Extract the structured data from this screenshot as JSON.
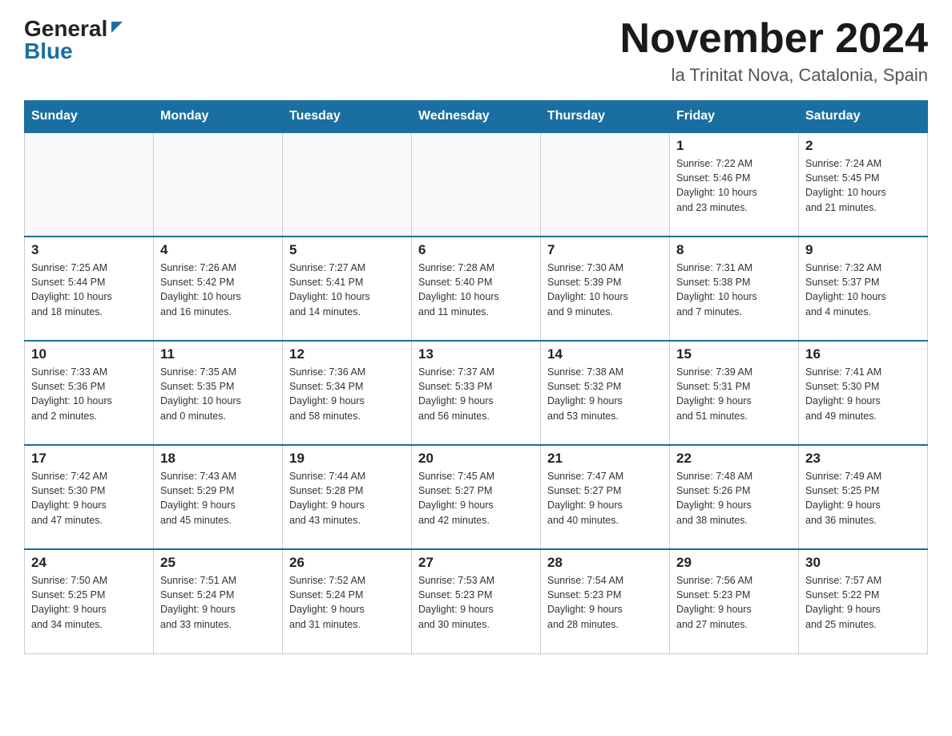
{
  "header": {
    "logo_general": "General",
    "logo_blue": "Blue",
    "month_title": "November 2024",
    "location": "la Trinitat Nova, Catalonia, Spain"
  },
  "days_of_week": [
    "Sunday",
    "Monday",
    "Tuesday",
    "Wednesday",
    "Thursday",
    "Friday",
    "Saturday"
  ],
  "weeks": [
    [
      {
        "day": "",
        "info": ""
      },
      {
        "day": "",
        "info": ""
      },
      {
        "day": "",
        "info": ""
      },
      {
        "day": "",
        "info": ""
      },
      {
        "day": "",
        "info": ""
      },
      {
        "day": "1",
        "info": "Sunrise: 7:22 AM\nSunset: 5:46 PM\nDaylight: 10 hours\nand 23 minutes."
      },
      {
        "day": "2",
        "info": "Sunrise: 7:24 AM\nSunset: 5:45 PM\nDaylight: 10 hours\nand 21 minutes."
      }
    ],
    [
      {
        "day": "3",
        "info": "Sunrise: 7:25 AM\nSunset: 5:44 PM\nDaylight: 10 hours\nand 18 minutes."
      },
      {
        "day": "4",
        "info": "Sunrise: 7:26 AM\nSunset: 5:42 PM\nDaylight: 10 hours\nand 16 minutes."
      },
      {
        "day": "5",
        "info": "Sunrise: 7:27 AM\nSunset: 5:41 PM\nDaylight: 10 hours\nand 14 minutes."
      },
      {
        "day": "6",
        "info": "Sunrise: 7:28 AM\nSunset: 5:40 PM\nDaylight: 10 hours\nand 11 minutes."
      },
      {
        "day": "7",
        "info": "Sunrise: 7:30 AM\nSunset: 5:39 PM\nDaylight: 10 hours\nand 9 minutes."
      },
      {
        "day": "8",
        "info": "Sunrise: 7:31 AM\nSunset: 5:38 PM\nDaylight: 10 hours\nand 7 minutes."
      },
      {
        "day": "9",
        "info": "Sunrise: 7:32 AM\nSunset: 5:37 PM\nDaylight: 10 hours\nand 4 minutes."
      }
    ],
    [
      {
        "day": "10",
        "info": "Sunrise: 7:33 AM\nSunset: 5:36 PM\nDaylight: 10 hours\nand 2 minutes."
      },
      {
        "day": "11",
        "info": "Sunrise: 7:35 AM\nSunset: 5:35 PM\nDaylight: 10 hours\nand 0 minutes."
      },
      {
        "day": "12",
        "info": "Sunrise: 7:36 AM\nSunset: 5:34 PM\nDaylight: 9 hours\nand 58 minutes."
      },
      {
        "day": "13",
        "info": "Sunrise: 7:37 AM\nSunset: 5:33 PM\nDaylight: 9 hours\nand 56 minutes."
      },
      {
        "day": "14",
        "info": "Sunrise: 7:38 AM\nSunset: 5:32 PM\nDaylight: 9 hours\nand 53 minutes."
      },
      {
        "day": "15",
        "info": "Sunrise: 7:39 AM\nSunset: 5:31 PM\nDaylight: 9 hours\nand 51 minutes."
      },
      {
        "day": "16",
        "info": "Sunrise: 7:41 AM\nSunset: 5:30 PM\nDaylight: 9 hours\nand 49 minutes."
      }
    ],
    [
      {
        "day": "17",
        "info": "Sunrise: 7:42 AM\nSunset: 5:30 PM\nDaylight: 9 hours\nand 47 minutes."
      },
      {
        "day": "18",
        "info": "Sunrise: 7:43 AM\nSunset: 5:29 PM\nDaylight: 9 hours\nand 45 minutes."
      },
      {
        "day": "19",
        "info": "Sunrise: 7:44 AM\nSunset: 5:28 PM\nDaylight: 9 hours\nand 43 minutes."
      },
      {
        "day": "20",
        "info": "Sunrise: 7:45 AM\nSunset: 5:27 PM\nDaylight: 9 hours\nand 42 minutes."
      },
      {
        "day": "21",
        "info": "Sunrise: 7:47 AM\nSunset: 5:27 PM\nDaylight: 9 hours\nand 40 minutes."
      },
      {
        "day": "22",
        "info": "Sunrise: 7:48 AM\nSunset: 5:26 PM\nDaylight: 9 hours\nand 38 minutes."
      },
      {
        "day": "23",
        "info": "Sunrise: 7:49 AM\nSunset: 5:25 PM\nDaylight: 9 hours\nand 36 minutes."
      }
    ],
    [
      {
        "day": "24",
        "info": "Sunrise: 7:50 AM\nSunset: 5:25 PM\nDaylight: 9 hours\nand 34 minutes."
      },
      {
        "day": "25",
        "info": "Sunrise: 7:51 AM\nSunset: 5:24 PM\nDaylight: 9 hours\nand 33 minutes."
      },
      {
        "day": "26",
        "info": "Sunrise: 7:52 AM\nSunset: 5:24 PM\nDaylight: 9 hours\nand 31 minutes."
      },
      {
        "day": "27",
        "info": "Sunrise: 7:53 AM\nSunset: 5:23 PM\nDaylight: 9 hours\nand 30 minutes."
      },
      {
        "day": "28",
        "info": "Sunrise: 7:54 AM\nSunset: 5:23 PM\nDaylight: 9 hours\nand 28 minutes."
      },
      {
        "day": "29",
        "info": "Sunrise: 7:56 AM\nSunset: 5:23 PM\nDaylight: 9 hours\nand 27 minutes."
      },
      {
        "day": "30",
        "info": "Sunrise: 7:57 AM\nSunset: 5:22 PM\nDaylight: 9 hours\nand 25 minutes."
      }
    ]
  ]
}
